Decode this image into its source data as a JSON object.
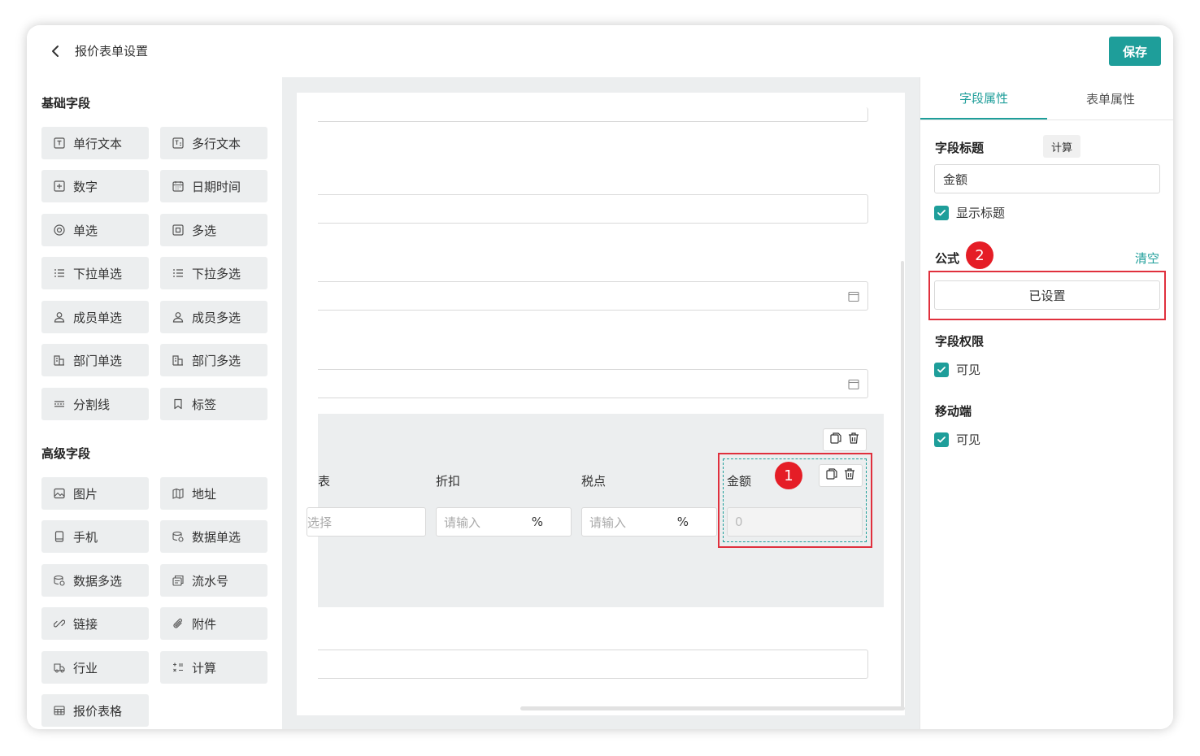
{
  "header": {
    "title": "报价表单设置",
    "save_label": "保存"
  },
  "left": {
    "basic_title": "基础字段",
    "basic_fields": [
      {
        "label": "单行文本",
        "icon": "text-box-icon"
      },
      {
        "label": "多行文本",
        "icon": "multiline-text-icon"
      },
      {
        "label": "数字",
        "icon": "number-icon"
      },
      {
        "label": "日期时间",
        "icon": "calendar-icon"
      },
      {
        "label": "单选",
        "icon": "radio-icon"
      },
      {
        "label": "多选",
        "icon": "checkbox-icon"
      },
      {
        "label": "下拉单选",
        "icon": "list-icon"
      },
      {
        "label": "下拉多选",
        "icon": "list-icon"
      },
      {
        "label": "成员单选",
        "icon": "user-icon"
      },
      {
        "label": "成员多选",
        "icon": "user-icon"
      },
      {
        "label": "部门单选",
        "icon": "department-icon"
      },
      {
        "label": "部门多选",
        "icon": "department-icon"
      },
      {
        "label": "分割线",
        "icon": "divider-icon"
      },
      {
        "label": "标签",
        "icon": "bookmark-icon"
      }
    ],
    "advanced_title": "高级字段",
    "advanced_fields": [
      {
        "label": "图片",
        "icon": "image-icon"
      },
      {
        "label": "地址",
        "icon": "map-icon"
      },
      {
        "label": "手机",
        "icon": "phone-icon"
      },
      {
        "label": "数据单选",
        "icon": "database-icon"
      },
      {
        "label": "数据多选",
        "icon": "database-icon"
      },
      {
        "label": "流水号",
        "icon": "serial-icon"
      },
      {
        "label": "链接",
        "icon": "link-icon"
      },
      {
        "label": "附件",
        "icon": "attachment-icon"
      },
      {
        "label": "行业",
        "icon": "industry-icon"
      },
      {
        "label": "计算",
        "icon": "calculator-icon"
      },
      {
        "label": "报价表格",
        "icon": "table-icon"
      }
    ]
  },
  "canvas": {
    "table": {
      "columns": [
        "表",
        "折扣",
        "税点",
        "金额"
      ],
      "cells": {
        "select_placeholder": "选择",
        "discount_placeholder": "请输入",
        "tax_placeholder": "请输入",
        "percent": "%",
        "amount_value": "0"
      }
    }
  },
  "right": {
    "tabs": [
      "字段属性",
      "表单属性"
    ],
    "field_title_label": "字段标题",
    "calc_tag": "计算",
    "field_title_value": "金额",
    "show_title_label": "显示标题",
    "formula_label": "公式",
    "clear_label": "清空",
    "formula_button": "已设置",
    "permission_label": "字段权限",
    "visible_label": "可见",
    "mobile_label": "移动端",
    "mobile_visible_label": "可见"
  },
  "annotations": {
    "badge1": "1",
    "badge2": "2",
    "accent_red": "#e51d26"
  },
  "theme": {
    "accent": "#1e9e9a"
  }
}
